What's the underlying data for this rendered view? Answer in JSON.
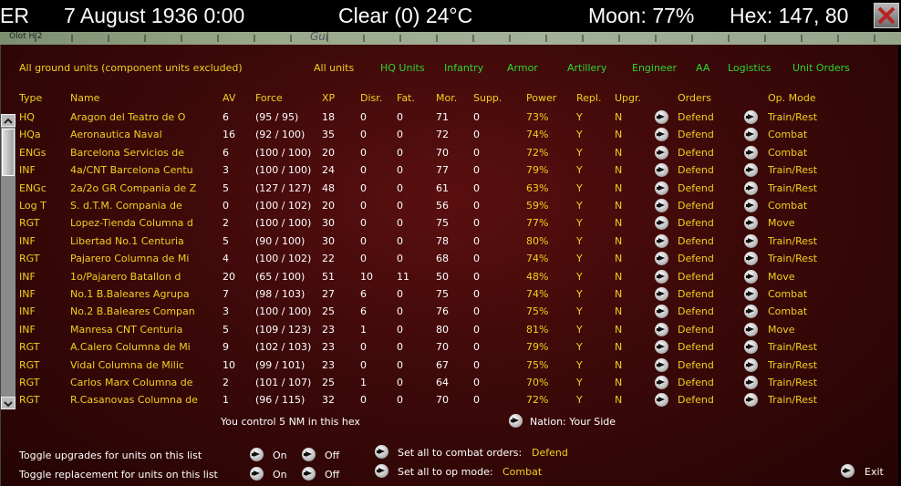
{
  "topbar": {
    "faction": "ER",
    "date": "7 August 1936 0:00",
    "weather": "Clear (0) 24°C",
    "moon": "Moon: 77%",
    "hex": "Hex: 147, 80"
  },
  "map_strip": {
    "label_left": "Olot  H'2",
    "label_mid": "Gul"
  },
  "filters": {
    "title": "All ground units (component units excluded)",
    "items": [
      "All units",
      "HQ Units",
      "Infantry",
      "Armor",
      "Artillery",
      "Engineer",
      "AA",
      "Logistics",
      "Unit Orders"
    ]
  },
  "columns": [
    "Type",
    "Name",
    "AV",
    "Force",
    "XP",
    "Disr.",
    "Fat.",
    "Mor.",
    "Supp.",
    "Power",
    "Repl.",
    "Upgr.",
    "Orders",
    "Op. Mode"
  ],
  "rows": [
    {
      "type": "HQ",
      "name": "Aragon del Teatro de O",
      "av": "6",
      "force": "(95 / 95)",
      "xp": "18",
      "disr": "0",
      "fat": "0",
      "mor": "71",
      "supp": "0",
      "power": "73%",
      "repl": "Y",
      "upgr": "N",
      "orders": "Defend",
      "mode": "Train/Rest"
    },
    {
      "type": "HQa",
      "name": "Aeronautica Naval",
      "av": "16",
      "force": "(92 / 100)",
      "xp": "35",
      "disr": "0",
      "fat": "0",
      "mor": "72",
      "supp": "0",
      "power": "74%",
      "repl": "Y",
      "upgr": "N",
      "orders": "Defend",
      "mode": "Combat"
    },
    {
      "type": "ENGs",
      "name": "Barcelona Servicios de",
      "av": "6",
      "force": "(100 / 100)",
      "xp": "20",
      "disr": "0",
      "fat": "0",
      "mor": "70",
      "supp": "0",
      "power": "72%",
      "repl": "Y",
      "upgr": "N",
      "orders": "Defend",
      "mode": "Combat"
    },
    {
      "type": "INF",
      "name": "4a/CNT Barcelona Centu",
      "av": "3",
      "force": "(100 / 100)",
      "xp": "24",
      "disr": "0",
      "fat": "0",
      "mor": "77",
      "supp": "0",
      "power": "79%",
      "repl": "Y",
      "upgr": "N",
      "orders": "Defend",
      "mode": "Train/Rest"
    },
    {
      "type": "ENGc",
      "name": "2a/2o GR Compania de Z",
      "av": "5",
      "force": "(127 / 127)",
      "xp": "48",
      "disr": "0",
      "fat": "0",
      "mor": "61",
      "supp": "0",
      "power": "63%",
      "repl": "Y",
      "upgr": "N",
      "orders": "Defend",
      "mode": "Train/Rest"
    },
    {
      "type": "Log T",
      "name": "S. d.T.M. Compania de",
      "av": "0",
      "force": "(100 / 102)",
      "xp": "20",
      "disr": "0",
      "fat": "0",
      "mor": "56",
      "supp": "0",
      "power": "59%",
      "repl": "Y",
      "upgr": "N",
      "orders": "Defend",
      "mode": "Combat"
    },
    {
      "type": "RGT",
      "name": "Lopez-Tienda Columna d",
      "av": "2",
      "force": "(100 / 100)",
      "xp": "30",
      "disr": "0",
      "fat": "0",
      "mor": "75",
      "supp": "0",
      "power": "77%",
      "repl": "Y",
      "upgr": "N",
      "orders": "Defend",
      "mode": "Move"
    },
    {
      "type": "INF",
      "name": "Libertad No.1 Centuria",
      "av": "5",
      "force": "(90 / 100)",
      "xp": "30",
      "disr": "0",
      "fat": "0",
      "mor": "78",
      "supp": "0",
      "power": "80%",
      "repl": "Y",
      "upgr": "N",
      "orders": "Defend",
      "mode": "Train/Rest"
    },
    {
      "type": "RGT",
      "name": "Pajarero Columna de Mi",
      "av": "4",
      "force": "(100 / 102)",
      "xp": "22",
      "disr": "0",
      "fat": "0",
      "mor": "68",
      "supp": "0",
      "power": "74%",
      "repl": "Y",
      "upgr": "N",
      "orders": "Defend",
      "mode": "Train/Rest"
    },
    {
      "type": "INF",
      "name": "1o/Pajarero Batallon d",
      "av": "20",
      "force": "(65 / 100)",
      "xp": "51",
      "disr": "10",
      "fat": "11",
      "mor": "50",
      "supp": "0",
      "power": "48%",
      "repl": "Y",
      "upgr": "N",
      "orders": "Defend",
      "mode": "Move"
    },
    {
      "type": "INF",
      "name": "No.1 B.Baleares Agrupa",
      "av": "7",
      "force": "(98 / 103)",
      "xp": "27",
      "disr": "6",
      "fat": "0",
      "mor": "75",
      "supp": "0",
      "power": "74%",
      "repl": "Y",
      "upgr": "N",
      "orders": "Defend",
      "mode": "Combat"
    },
    {
      "type": "INF",
      "name": "No.2 B.Baleares Compan",
      "av": "3",
      "force": "(100 / 100)",
      "xp": "25",
      "disr": "6",
      "fat": "0",
      "mor": "76",
      "supp": "0",
      "power": "75%",
      "repl": "Y",
      "upgr": "N",
      "orders": "Defend",
      "mode": "Combat"
    },
    {
      "type": "INF",
      "name": "Manresa CNT Centuria",
      "av": "5",
      "force": "(109 / 123)",
      "xp": "23",
      "disr": "1",
      "fat": "0",
      "mor": "80",
      "supp": "0",
      "power": "81%",
      "repl": "Y",
      "upgr": "N",
      "orders": "Defend",
      "mode": "Move"
    },
    {
      "type": "RGT",
      "name": "A.Calero Columna de Mi",
      "av": "9",
      "force": "(102 / 103)",
      "xp": "23",
      "disr": "0",
      "fat": "0",
      "mor": "70",
      "supp": "0",
      "power": "79%",
      "repl": "Y",
      "upgr": "N",
      "orders": "Defend",
      "mode": "Train/Rest"
    },
    {
      "type": "RGT",
      "name": "Vidal Columna de Milic",
      "av": "10",
      "force": "(99 / 101)",
      "xp": "23",
      "disr": "0",
      "fat": "0",
      "mor": "67",
      "supp": "0",
      "power": "75%",
      "repl": "Y",
      "upgr": "N",
      "orders": "Defend",
      "mode": "Train/Rest"
    },
    {
      "type": "RGT",
      "name": "Carlos Marx Columna de",
      "av": "2",
      "force": "(101 / 107)",
      "xp": "25",
      "disr": "1",
      "fat": "0",
      "mor": "64",
      "supp": "0",
      "power": "70%",
      "repl": "Y",
      "upgr": "N",
      "orders": "Defend",
      "mode": "Train/Rest"
    },
    {
      "type": "RGT",
      "name": "R.Casanovas Columna de",
      "av": "1",
      "force": "(96 / 115)",
      "xp": "32",
      "disr": "0",
      "fat": "0",
      "mor": "70",
      "supp": "0",
      "power": "72%",
      "repl": "Y",
      "upgr": "N",
      "orders": "Defend",
      "mode": "Train/Rest"
    }
  ],
  "footer": {
    "control_text": "You control 5 NM in this hex",
    "nation_text": "Nation: Your Side",
    "toggle_upgrades": "Toggle upgrades for units on this list",
    "toggle_replacement": "Toggle replacement for units on this list",
    "on": "On",
    "off": "Off",
    "set_combat_label": "Set all to combat orders:",
    "set_combat_value": "Defend",
    "set_opmode_label": "Set all to op mode:",
    "set_opmode_value": "Combat",
    "exit": "Exit"
  },
  "colors": {
    "header_yellow": "#f2cf1f",
    "filter_green": "#2fd62f",
    "panel_red": "#3d0909"
  },
  "icons": [
    "close-icon",
    "arrow-right-icon",
    "scroll-up-icon",
    "scroll-down-icon"
  ]
}
